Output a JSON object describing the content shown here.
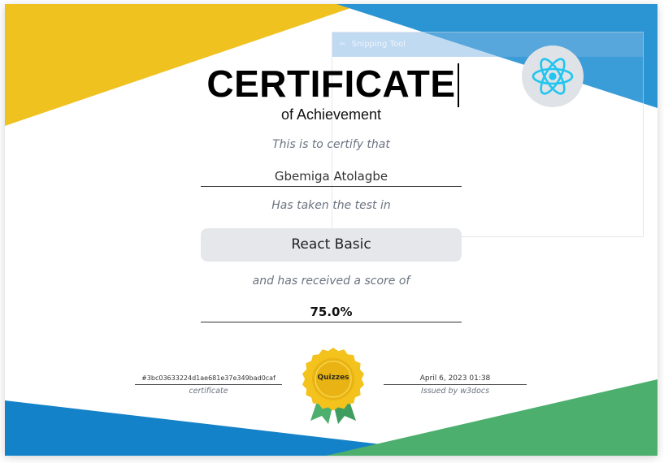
{
  "certificate": {
    "title": "CERTIFICATE",
    "subtitle": "of Achievement",
    "certify_text": "This is to certify that",
    "recipient_name": "Gbemiga Atolagbe",
    "taken_text": "Has taken the test in",
    "course_name": "React Basic",
    "received_text": "and has received a score of",
    "score": "75.0%",
    "certificate_id": "#3bc03633224d1ae681e37e349bad0caf",
    "certificate_label": "certificate",
    "issued_date": "April 6, 2023 01:38",
    "issued_label": "Issued by w3docs",
    "medal_text": "Quizzes"
  },
  "overlay": {
    "snipping_tool_title": "Snipping Tool"
  },
  "icons": {
    "course_logo": "react-logo-icon",
    "medal": "medal-badge-icon",
    "snipping_tool": "scissors-icon"
  },
  "colors": {
    "corner_yellow": "#efc220",
    "corner_blue": "#2b95d4",
    "bottom_blue": "#1482c8",
    "bottom_green": "#4caf6d",
    "react_cyan": "#22c5ef",
    "medal_gold": "#f3c21d",
    "ribbon_green": "#4caf6d"
  }
}
